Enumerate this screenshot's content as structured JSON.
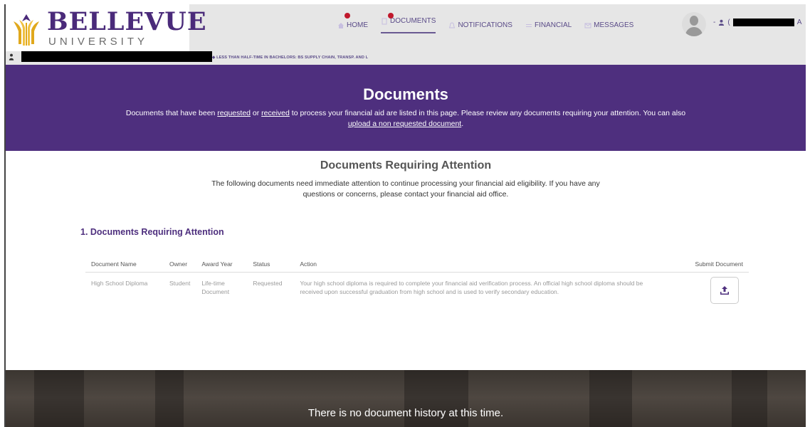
{
  "brand": {
    "name": "BELLEVUE",
    "subname": "UNIVERSITY",
    "colors": {
      "purple": "#4e2f7e",
      "header_bg": "#e6e6e6",
      "badge": "#c0182c"
    }
  },
  "nav": {
    "items": [
      {
        "label": "HOME",
        "icon": "home-icon",
        "badge": true
      },
      {
        "label": "DOCUMENTS",
        "icon": "documents-icon",
        "badge": true,
        "active": true
      },
      {
        "label": "NOTIFICATIONS",
        "icon": "bell-icon",
        "badge": false
      },
      {
        "label": "FINANCIAL",
        "icon": "financial-icon",
        "badge": false
      },
      {
        "label": "MESSAGES",
        "icon": "envelope-icon",
        "badge": false
      }
    ]
  },
  "user": {
    "icon": "user-icon",
    "suffix": "A"
  },
  "enrollment": "LESS THAN HALF-TIME IN BACHELORS: BS SUPPLY CHAIN, TRANSP. AND L",
  "banner": {
    "title": "Documents",
    "text_1": "Documents that have been ",
    "link_requested": "requested",
    "text_2": " or ",
    "link_received": "received",
    "text_3": " to process your financial aid are listed in this page. Please review any documents requiring your attention. You can also ",
    "link_upload": "upload a non requested document",
    "text_4": "."
  },
  "attention": {
    "title": "Documents Requiring Attention",
    "description": "The following documents need immediate attention to continue processing your financial aid eligibility. If you have any questions or concerns, please contact your financial aid office.",
    "subtitle": "1. Documents Requiring Attention",
    "columns": [
      "Document Name",
      "Owner",
      "Award Year",
      "Status",
      "Action",
      "Submit Document"
    ],
    "rows": [
      {
        "document_name": "High School Diploma",
        "owner": "Student",
        "award_year": "Life-time Document",
        "status": "Requested",
        "action": "Your high school diploma is required to complete your financial aid verification process. An official high school diploma should be received upon successful graduation from high school and is used to verify secondary education."
      }
    ]
  },
  "history": {
    "message": "There is no document history at this time."
  }
}
